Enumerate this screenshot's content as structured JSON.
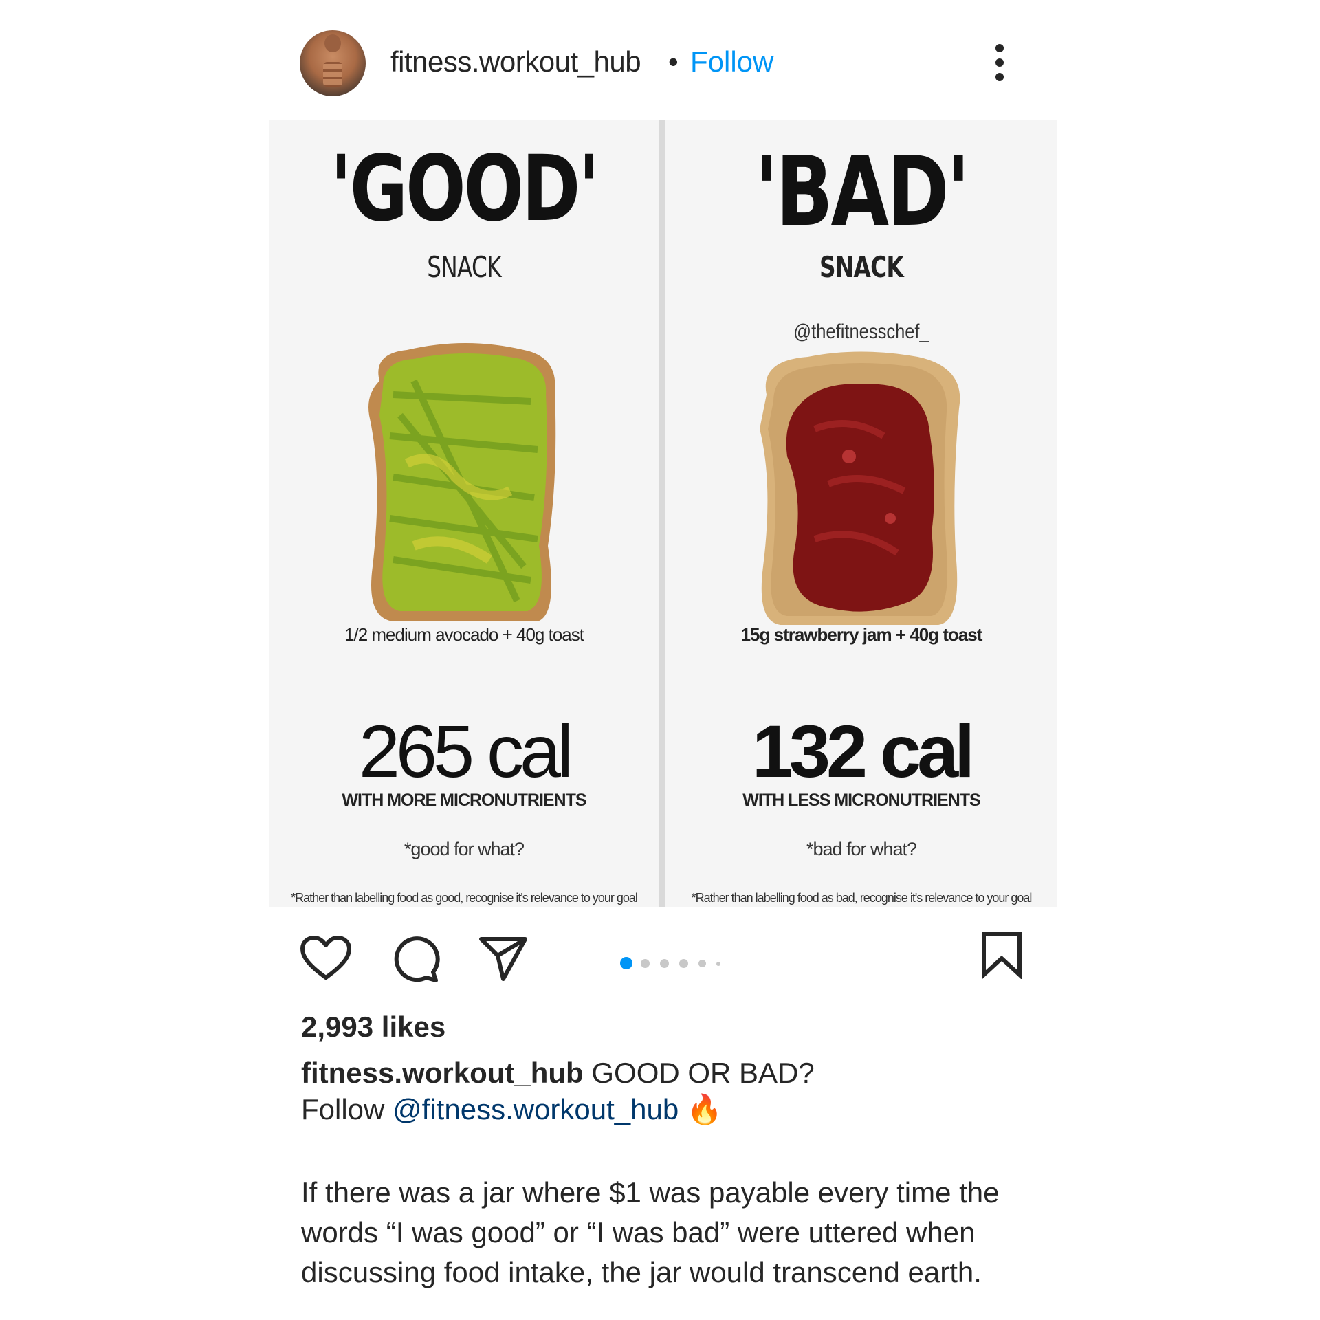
{
  "header": {
    "username": "fitness.workout_hub",
    "separator": "•",
    "follow_label": "Follow"
  },
  "post_image": {
    "left": {
      "title": "'GOOD'",
      "subtitle": "SNACK",
      "food_description": "1/2 medium avocado + 40g toast",
      "calories": "265 cal",
      "micronutrients": "WITH MORE MICRONUTRIENTS",
      "question": "*good for what?",
      "footnote": "*Rather than labelling food as good, recognise it's relevance  to your goal",
      "food_icon": "avocado-toast"
    },
    "right": {
      "title": "'BAD'",
      "subtitle": "SNACK",
      "credit": "@thefitnesschef_",
      "food_description": "15g strawberry jam + 40g toast",
      "calories": "132 cal",
      "micronutrients": "WITH LESS MICRONUTRIENTS",
      "question": "*bad for what?",
      "footnote": "*Rather than labelling food as bad, recognise it's relevance  to your goal",
      "food_icon": "jam-toast"
    }
  },
  "actions": {
    "icons": [
      "heart-icon",
      "comment-icon",
      "share-icon",
      "bookmark-icon"
    ],
    "carousel": {
      "total_dots": 6,
      "active_index": 0
    }
  },
  "likes": "2,993 likes",
  "caption": {
    "username": "fitness.workout_hub",
    "text": " GOOD OR BAD?",
    "follow_prefix": "Follow ",
    "mention": "@fitness.workout_hub",
    "emoji": "🔥",
    "body": "If there was a jar where $1 was payable every time the words “I was good” or “I was bad” were uttered when discussing food intake, the jar would transcend earth."
  },
  "colors": {
    "link_blue": "#0095f6",
    "mention_blue": "#00376b",
    "text": "#262626",
    "image_bg": "#f5f5f5"
  }
}
